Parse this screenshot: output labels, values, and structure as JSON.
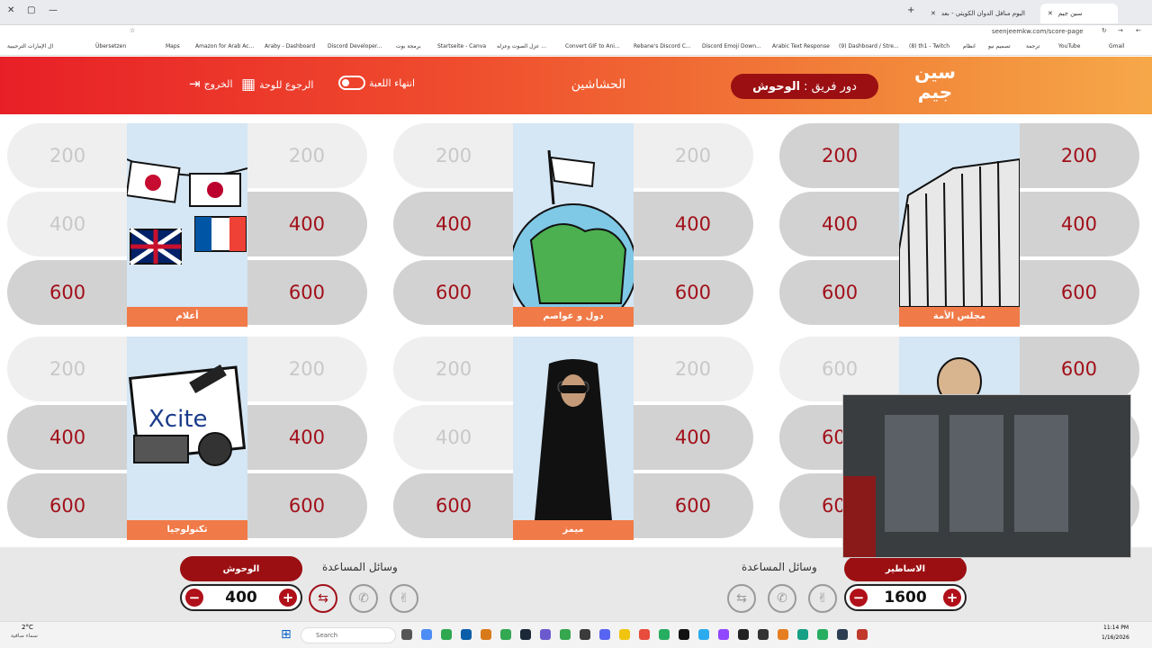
{
  "browser": {
    "tabs": [
      {
        "label": "سين جيم",
        "active": true
      },
      {
        "label": "اليوم منافل الدوان الكويتي - بعد",
        "active": false
      }
    ],
    "address": "seenjeemkw.com/score-page",
    "bookmarks": [
      "Übersetzen",
      "Maps",
      "Amazon for Arab Ac...",
      "Araby - Dashboard",
      "Discord Developer...",
      "برمجة بوت",
      "Startseite - Canva",
      "عزل الصوت وعزله ...",
      "Convert GIF to Ani...",
      "Rebane's Discord C...",
      "Discord Emoji Down...",
      "Arabic Text Response",
      "(9) Dashboard / Stre...",
      "(8) th1 - Twitch",
      "انظام",
      "تصميم نيو",
      "ترجمة",
      "YouTube",
      "Gmail",
      "ال الإمارات الترحيبية"
    ]
  },
  "header": {
    "logo": "سين جيم",
    "turn_prefix": "دور فريق :",
    "turn_team": "الوحوش",
    "title": "الحشاشين",
    "end_game": "انتهاء اللعبة",
    "back_to_board": "الرجوع للوحة",
    "exit": "الخروج"
  },
  "categories": [
    {
      "label": "مجلس الأمة",
      "left": [
        "200",
        "400",
        "600"
      ],
      "right": [
        "200",
        "400",
        "600"
      ],
      "left_state": [
        "avail",
        "avail",
        "avail"
      ],
      "right_state": [
        "avail",
        "avail",
        "avail"
      ]
    },
    {
      "label": "دول و عواصم",
      "left": [
        "200",
        "400",
        "600"
      ],
      "right": [
        "200",
        "400",
        "600"
      ],
      "left_state": [
        "done",
        "avail",
        "avail"
      ],
      "right_state": [
        "done",
        "avail",
        "avail"
      ]
    },
    {
      "label": "أعلام",
      "left": [
        "200",
        "400",
        "600"
      ],
      "right": [
        "200",
        "400",
        "600"
      ],
      "left_state": [
        "done",
        "done",
        "avail"
      ],
      "right_state": [
        "done",
        "avail",
        "avail"
      ]
    },
    {
      "label": "",
      "left": [
        "600",
        "600",
        "600"
      ],
      "right": [
        "600",
        "600",
        "600"
      ],
      "left_state": [
        "done",
        "avail",
        "avail"
      ],
      "right_state": [
        "avail",
        "avail",
        "avail"
      ]
    },
    {
      "label": "ميمز",
      "left": [
        "200",
        "400",
        "600"
      ],
      "right": [
        "200",
        "400",
        "600"
      ],
      "left_state": [
        "done",
        "done",
        "avail"
      ],
      "right_state": [
        "done",
        "avail",
        "avail"
      ]
    },
    {
      "label": "تكنولوجيا",
      "left": [
        "200",
        "400",
        "600"
      ],
      "right": [
        "200",
        "400",
        "600"
      ],
      "left_state": [
        "done",
        "avail",
        "avail"
      ],
      "right_state": [
        "done",
        "avail",
        "avail"
      ]
    }
  ],
  "teams": [
    {
      "name": "الاساطير",
      "score": "1600",
      "aids_label": "وسائل المساعدة"
    },
    {
      "name": "الوحوش",
      "score": "400",
      "aids_label": "وسائل المساعدة"
    }
  ],
  "taskbar": {
    "weather": "2°C",
    "weather_sub": "سماء صافية",
    "search_placeholder": "Search",
    "time": "11:14 PM",
    "date": "1/16/2026"
  },
  "colors": {
    "accent": "#a1101a",
    "header_left": "#e81f27",
    "header_right": "#f6a849",
    "label": "#f07a48"
  }
}
